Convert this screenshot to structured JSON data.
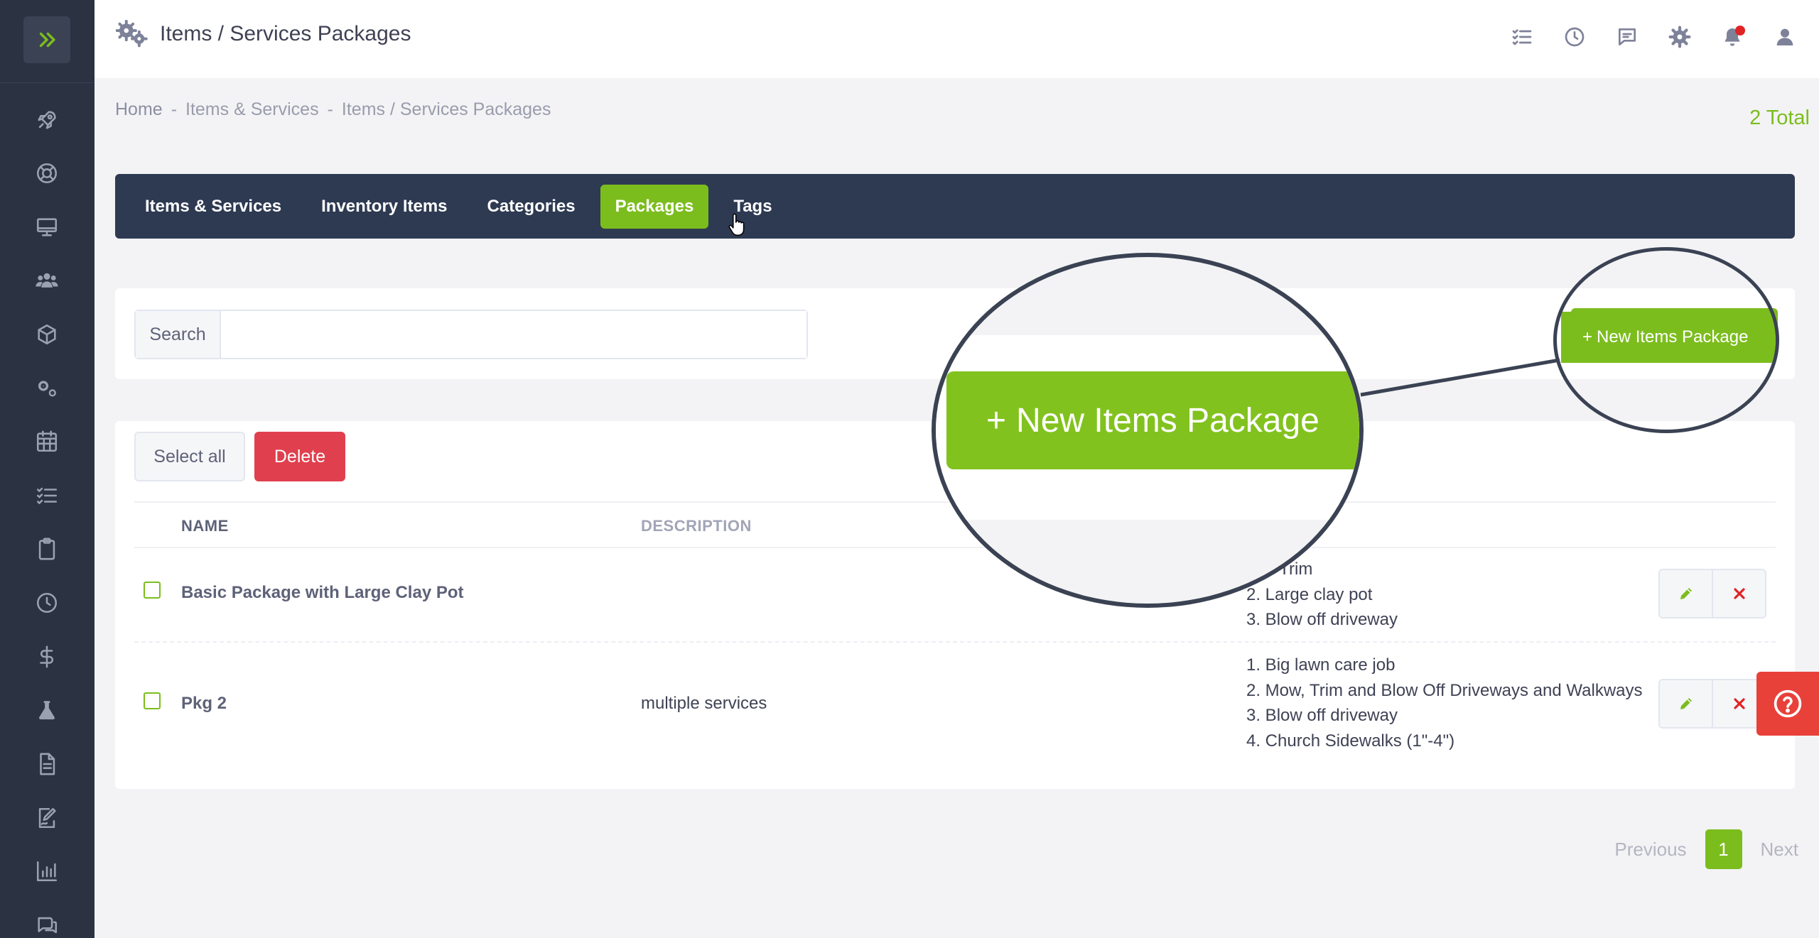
{
  "header": {
    "title": "Items / Services Packages"
  },
  "breadcrumb": {
    "home": "Home",
    "sep1": "-",
    "section": "Items & Services",
    "sep2": "-",
    "current": "Items / Services Packages"
  },
  "total_label": "2 Total",
  "tabs": [
    {
      "label": "Items & Services"
    },
    {
      "label": "Inventory Items"
    },
    {
      "label": "Categories"
    },
    {
      "label": "Packages",
      "active": true
    },
    {
      "label": "Tags"
    }
  ],
  "search": {
    "label": "Search",
    "value": "",
    "placeholder": ""
  },
  "new_button": {
    "plus": "+",
    "label": "New Items Package"
  },
  "bulk": {
    "select_all": "Select all",
    "delete": "Delete"
  },
  "table": {
    "columns": [
      "NAME",
      "DESCRIPTION"
    ],
    "rows": [
      {
        "name": "Basic Package with Large Clay Pot",
        "description": "",
        "items": [
          "and Trim",
          "2. Large clay pot",
          "3. Blow off driveway"
        ]
      },
      {
        "name": "Pkg 2",
        "description": "multiple services",
        "items": [
          "1. Big lawn care job",
          "2. Mow, Trim and Blow Off Driveways and Walkways",
          "3. Blow off driveway",
          "4. Church Sidewalks (1\"-4\")"
        ]
      }
    ]
  },
  "pagination": {
    "previous": "Previous",
    "current": "1",
    "next": "Next"
  },
  "colors": {
    "accent_green": "#7cbd1e",
    "sidebar": "#2b3242",
    "tabbar": "#2e3a52",
    "danger": "#e0404e",
    "help": "#e8413a"
  },
  "icons": {
    "sidebar": [
      "rocket-icon",
      "lifebuoy-icon",
      "monitor-icon",
      "users-icon",
      "box-icon",
      "gears-icon",
      "calendar-grid-icon",
      "checklist-icon",
      "clipboard-icon",
      "clock-icon",
      "dollar-icon",
      "flask-icon",
      "document-icon",
      "signature-icon",
      "bar-chart-icon",
      "chat-icon"
    ],
    "topbar": [
      "checklist-icon",
      "clock-icon",
      "message-icon",
      "gear-icon",
      "bell-icon",
      "user-icon"
    ]
  }
}
